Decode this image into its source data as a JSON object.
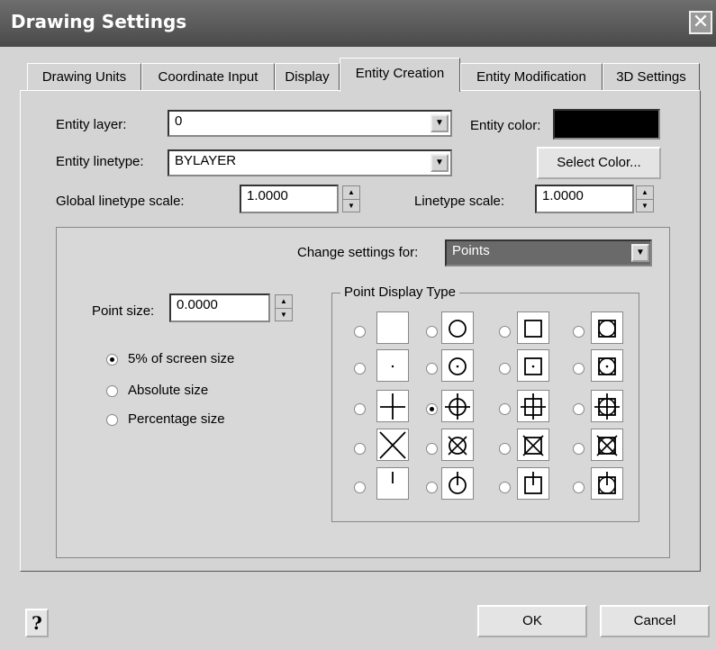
{
  "window": {
    "title": "Drawing Settings",
    "close_glyph": "✕"
  },
  "tabs": [
    {
      "label": "Drawing Units"
    },
    {
      "label": "Coordinate Input"
    },
    {
      "label": "Display"
    },
    {
      "label": "Entity Creation",
      "active": true
    },
    {
      "label": "Entity Modification"
    },
    {
      "label": "3D Settings"
    }
  ],
  "entity": {
    "layer_label": "Entity layer:",
    "layer_value": "0",
    "linetype_label": "Entity linetype:",
    "linetype_value": "BYLAYER",
    "color_label": "Entity color:",
    "color_value": "#000000",
    "select_color_button": "Select Color...",
    "global_scale_label": "Global linetype scale:",
    "global_scale_value": "1.0000",
    "linetype_scale_label": "Linetype scale:",
    "linetype_scale_value": "1.0000"
  },
  "change_settings": {
    "label": "Change settings for:",
    "value": "Points"
  },
  "point": {
    "size_label": "Point size:",
    "size_value": "0.0000",
    "options": [
      {
        "label": "5% of screen size",
        "checked": true
      },
      {
        "label": "Absolute size",
        "checked": false
      },
      {
        "label": "Percentage size",
        "checked": false
      }
    ],
    "display_type_label": "Point Display Type",
    "selected_type": "row-3-col-2"
  },
  "footer": {
    "help_label": "?",
    "ok_label": "OK",
    "cancel_label": "Cancel"
  },
  "colors": {
    "titlebar": "#5a5a5a",
    "dialog_bg": "#d4d4d4",
    "selected_dropdown": "#6a6a6a"
  }
}
